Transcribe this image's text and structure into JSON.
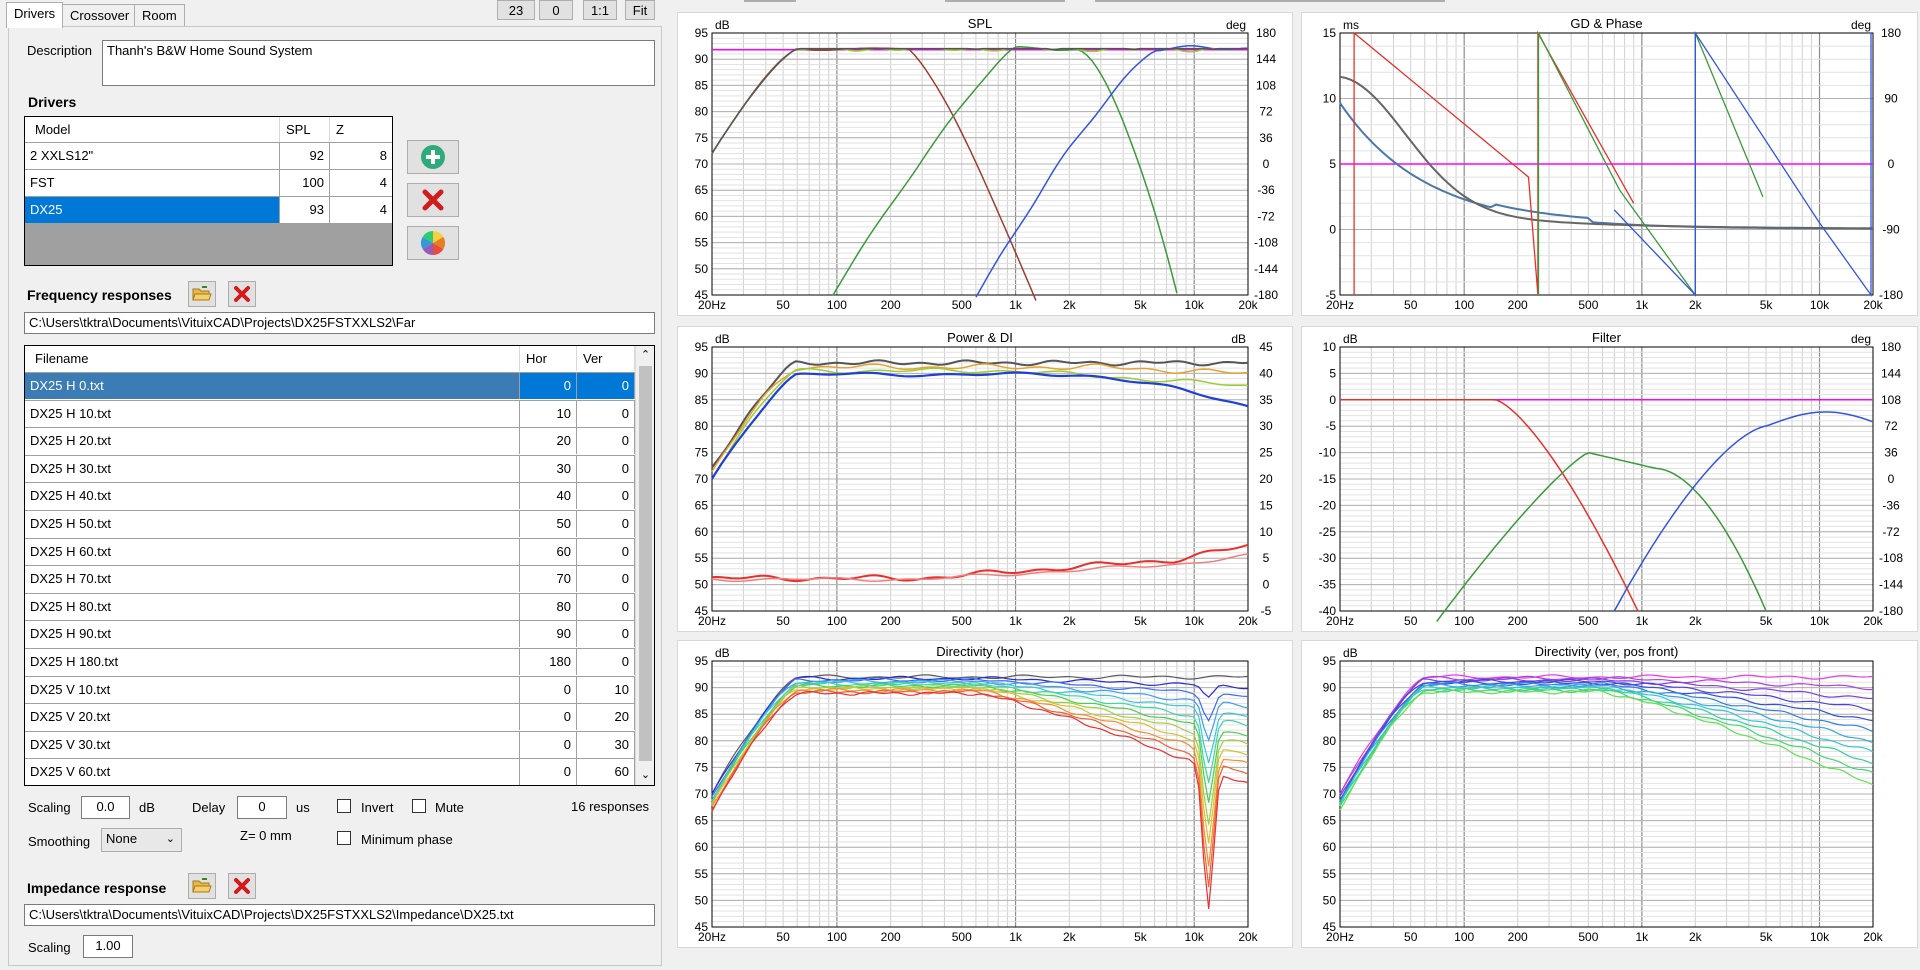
{
  "tabs": [
    {
      "label": "Drivers",
      "active": true
    },
    {
      "label": "Crossover",
      "active": false
    },
    {
      "label": "Room",
      "active": false
    }
  ],
  "top_buttons": [
    "23",
    "0",
    "1:1",
    "Fit"
  ],
  "description": {
    "label": "Description",
    "value": "Thanh's B&W Home Sound System"
  },
  "drivers": {
    "heading": "Drivers",
    "columns": [
      "Model",
      "SPL",
      "Z"
    ],
    "rows": [
      {
        "model": "2 XXLS12\"",
        "spl": "92",
        "z": "8",
        "selected": false
      },
      {
        "model": "FST",
        "spl": "100",
        "z": "4",
        "selected": false
      },
      {
        "model": "DX25",
        "spl": "93",
        "z": "4",
        "selected": true
      }
    ]
  },
  "driver_buttons": [
    {
      "name": "add",
      "icon": "plus-circle-icon"
    },
    {
      "name": "delete",
      "icon": "red-x-icon"
    },
    {
      "name": "color",
      "icon": "color-wheel-icon"
    }
  ],
  "frequency": {
    "heading": "Frequency responses",
    "path": "C:\\Users\\tktra\\Documents\\VituixCAD\\Projects\\DX25FSTXXLS2\\Far",
    "columns": [
      "Filename",
      "Hor",
      "Ver"
    ],
    "rows": [
      {
        "file": "DX25 H 0.txt",
        "hor": "0",
        "ver": "0"
      },
      {
        "file": "DX25 H 10.txt",
        "hor": "10",
        "ver": "0"
      },
      {
        "file": "DX25 H 20.txt",
        "hor": "20",
        "ver": "0"
      },
      {
        "file": "DX25 H 30.txt",
        "hor": "30",
        "ver": "0"
      },
      {
        "file": "DX25 H 40.txt",
        "hor": "40",
        "ver": "0"
      },
      {
        "file": "DX25 H 50.txt",
        "hor": "50",
        "ver": "0"
      },
      {
        "file": "DX25 H 60.txt",
        "hor": "60",
        "ver": "0"
      },
      {
        "file": "DX25 H 70.txt",
        "hor": "70",
        "ver": "0"
      },
      {
        "file": "DX25 H 80.txt",
        "hor": "80",
        "ver": "0"
      },
      {
        "file": "DX25 H 90.txt",
        "hor": "90",
        "ver": "0"
      },
      {
        "file": "DX25 H 180.txt",
        "hor": "180",
        "ver": "0"
      },
      {
        "file": "DX25 V 10.txt",
        "hor": "0",
        "ver": "10"
      },
      {
        "file": "DX25 V 20.txt",
        "hor": "0",
        "ver": "20"
      },
      {
        "file": "DX25 V 30.txt",
        "hor": "0",
        "ver": "30"
      },
      {
        "file": "DX25 V 60.txt",
        "hor": "0",
        "ver": "60"
      }
    ]
  },
  "controls": {
    "scaling_label": "Scaling",
    "scaling_value": "0.0",
    "scaling_unit": "dB",
    "delay_label": "Delay",
    "delay_value": "0",
    "delay_unit": "us",
    "invert_label": "Invert",
    "mute_label": "Mute",
    "responses_count": "16 responses",
    "smoothing_label": "Smoothing",
    "smoothing_value": "None",
    "z_label": "Z= 0 mm",
    "min_phase_label": "Minimum phase"
  },
  "impedance": {
    "heading": "Impedance response",
    "path": "C:\\Users\\tktra\\Documents\\VituixCAD\\Projects\\DX25FSTXXLS2\\Impedance\\DX25.txt",
    "scaling_label": "Scaling",
    "scaling_value": "1.00"
  },
  "x_ticks": [
    "20Hz",
    "50",
    "100",
    "200",
    "500",
    "1k",
    "2k",
    "5k",
    "10k",
    "20k"
  ],
  "charts": {
    "spl": {
      "title": "SPL",
      "left_unit": "dB",
      "right_unit": "deg",
      "left_ticks": [
        "95",
        "90",
        "85",
        "80",
        "75",
        "70",
        "65",
        "60",
        "55",
        "50",
        "45"
      ],
      "right_ticks": [
        "180",
        "144",
        "108",
        "72",
        "36",
        "0",
        "-36",
        "-72",
        "-108",
        "-144",
        "-180"
      ]
    },
    "gd": {
      "title": "GD & Phase",
      "left_unit": "ms",
      "right_unit": "deg",
      "left_ticks": [
        "15",
        "10",
        "5",
        "0",
        "-5"
      ],
      "right_ticks": [
        "180",
        "90",
        "0",
        "-90",
        "-180"
      ]
    },
    "power": {
      "title": "Power & DI",
      "left_unit": "dB",
      "right_unit": "dB",
      "left_ticks": [
        "95",
        "90",
        "85",
        "80",
        "75",
        "70",
        "65",
        "60",
        "55",
        "50",
        "45"
      ],
      "right_ticks": [
        "45",
        "40",
        "35",
        "30",
        "25",
        "20",
        "15",
        "10",
        "5",
        "0",
        "-5"
      ]
    },
    "filter": {
      "title": "Filter",
      "left_unit": "dB",
      "right_unit": "deg",
      "left_ticks": [
        "10",
        "5",
        "0",
        "-5",
        "-10",
        "-15",
        "-20",
        "-25",
        "-30",
        "-35",
        "-40"
      ],
      "right_ticks": [
        "180",
        "144",
        "108",
        "72",
        "36",
        "0",
        "-36",
        "-72",
        "-108",
        "-144",
        "-180"
      ]
    },
    "dirh": {
      "title": "Directivity (hor)",
      "left_unit": "dB",
      "left_ticks": [
        "95",
        "90",
        "85",
        "80",
        "75",
        "70",
        "65",
        "60",
        "55",
        "50",
        "45"
      ]
    },
    "dirv": {
      "title": "Directivity (ver, pos front)",
      "left_unit": "dB",
      "left_ticks": [
        "95",
        "90",
        "85",
        "80",
        "75",
        "70",
        "65",
        "60",
        "55",
        "50",
        "45"
      ]
    }
  }
}
